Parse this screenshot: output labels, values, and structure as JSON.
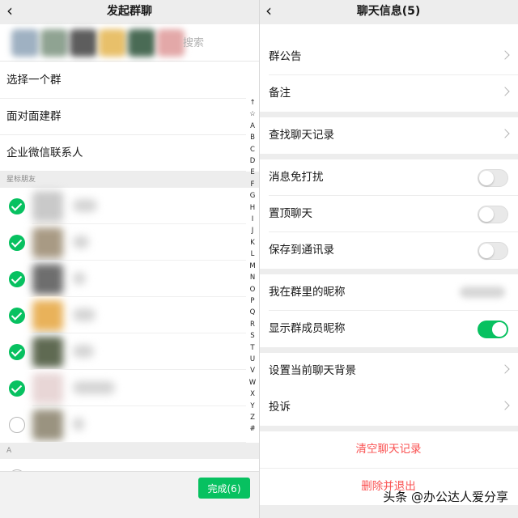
{
  "left": {
    "title": "发起群聊",
    "search": {
      "placeholder": "搜索"
    },
    "options": [
      "选择一个群",
      "面对面建群",
      "企业微信联系人"
    ],
    "starred_header": "星标朋友",
    "contacts": [
      {
        "checked": true
      },
      {
        "checked": true
      },
      {
        "checked": true
      },
      {
        "checked": true
      },
      {
        "checked": true
      },
      {
        "checked": true
      },
      {
        "checked": false
      }
    ],
    "section_a_header": "A",
    "index_letters": [
      "↑",
      "☆",
      "A",
      "B",
      "C",
      "D",
      "E",
      "F",
      "G",
      "H",
      "I",
      "J",
      "K",
      "L",
      "M",
      "N",
      "O",
      "P",
      "Q",
      "R",
      "S",
      "T",
      "U",
      "V",
      "W",
      "X",
      "Y",
      "Z",
      "#"
    ],
    "done_button": "完成(6)"
  },
  "right": {
    "title": "聊天信息(5)",
    "items": {
      "announcement": "群公告",
      "remark": "备注",
      "search_history": "查找聊天记录",
      "mute": "消息免打扰",
      "pin": "置顶聊天",
      "save_contacts": "保存到通讯录",
      "my_nickname": "我在群里的昵称",
      "show_nicknames": "显示群成员昵称",
      "background": "设置当前聊天背景",
      "report": "投诉",
      "clear_history": "清空聊天记录",
      "delete_exit": "删除并退出"
    },
    "toggles": {
      "mute": false,
      "pin": false,
      "save_contacts": false,
      "show_nicknames": true
    }
  },
  "watermark": "头条 @办公达人爱分享",
  "colors": {
    "accent": "#07c160",
    "danger": "#fa5151",
    "background": "#ededed"
  },
  "icons": {
    "back": "chevron-left-icon",
    "row": "chevron-right-icon",
    "check": "check-circle-icon"
  }
}
